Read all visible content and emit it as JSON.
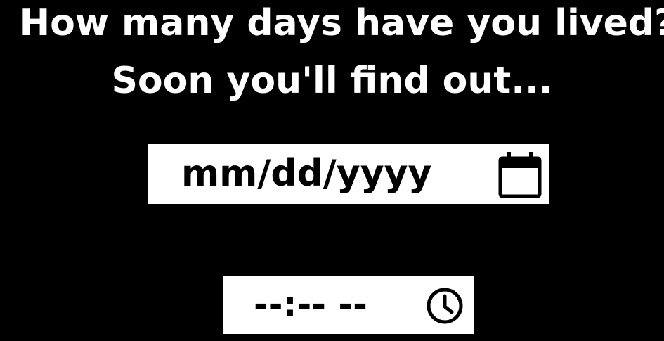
{
  "header": {
    "line1": "How many days have you lived?",
    "line2": "Soon you'll find out..."
  },
  "date_input": {
    "placeholder": "mm/dd/yyyy",
    "icon": "calendar-icon"
  },
  "time_input": {
    "placeholder": "--:-- --",
    "icon": "clock-icon"
  },
  "colors": {
    "background": "#000000",
    "text": "#ffffff",
    "field_background": "#ffffff",
    "field_text": "#000000"
  }
}
